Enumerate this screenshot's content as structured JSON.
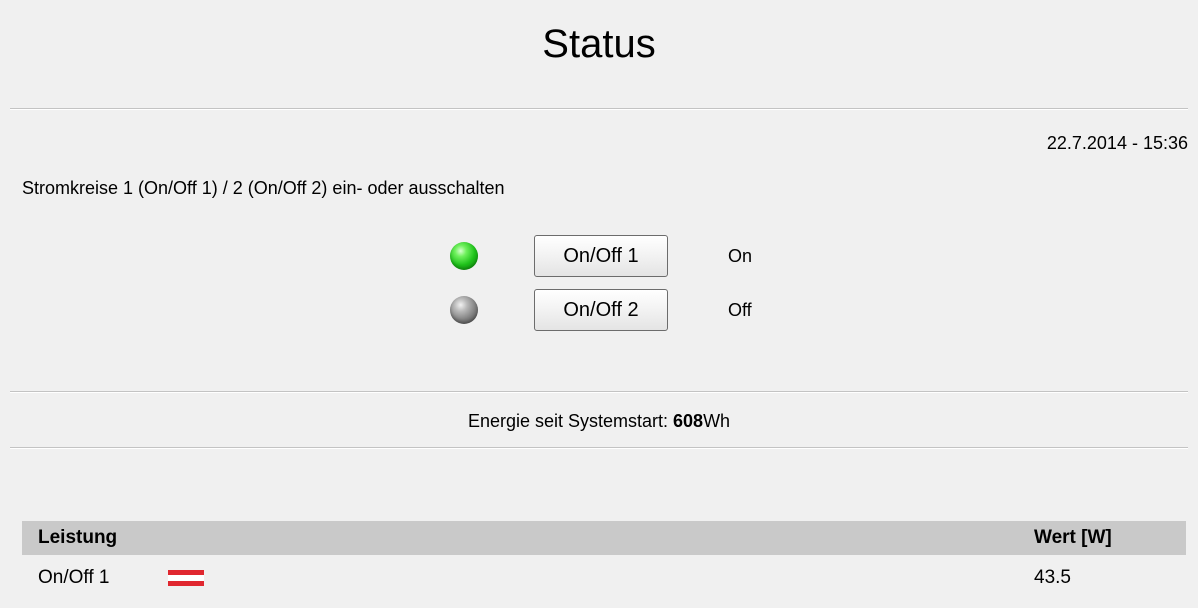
{
  "header": {
    "title": "Status"
  },
  "datetime": "22.7.2014 - 15:36",
  "instruction": "Stromkreise 1 (On/Off 1) / 2 (On/Off 2) ein- oder ausschalten",
  "circuits": [
    {
      "button_label": "On/Off 1",
      "state": "On",
      "led": "on",
      "led_color": "#1fc21b"
    },
    {
      "button_label": "On/Off 2",
      "state": "Off",
      "led": "off",
      "led_color": "#7d7d7d"
    }
  ],
  "energy": {
    "label": "Energie seit Systemstart: ",
    "value": "608",
    "unit": "Wh"
  },
  "table": {
    "headers": [
      "Leistung",
      "Wert [W]"
    ],
    "rows": [
      {
        "name": "On/Off 1",
        "icon": "flag-icon",
        "value": "43.5"
      }
    ]
  }
}
